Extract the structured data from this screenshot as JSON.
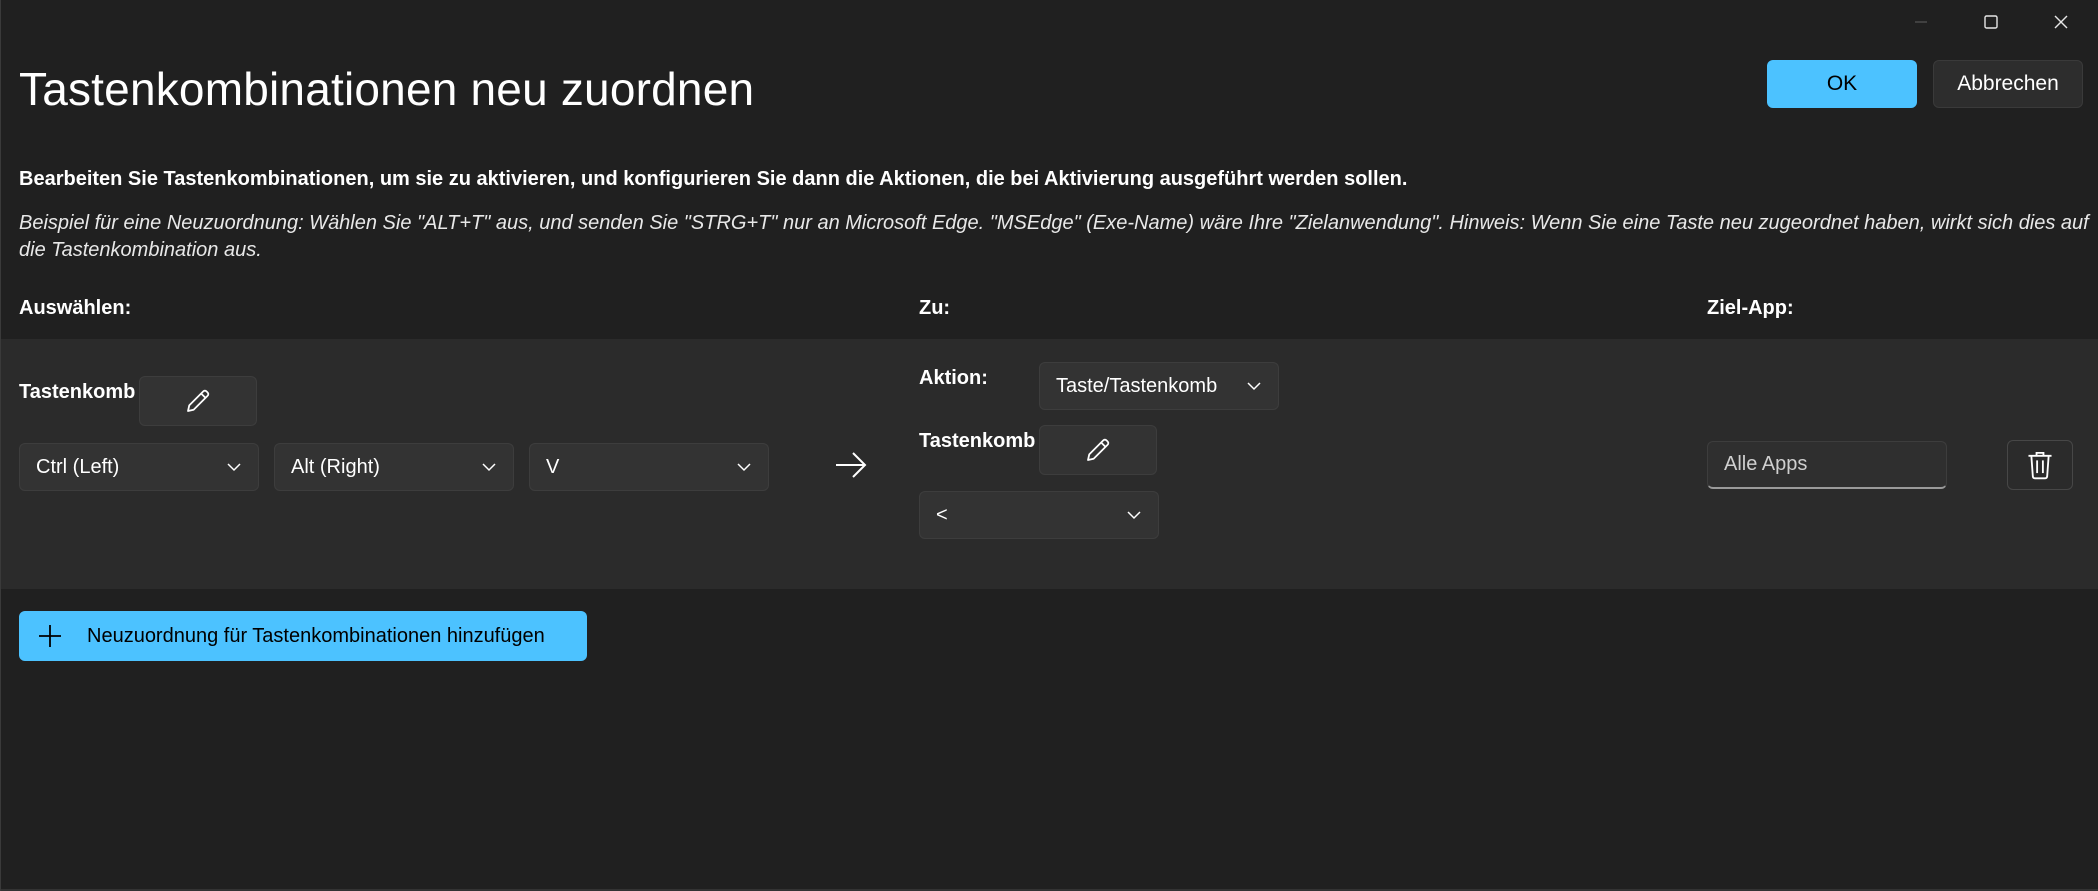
{
  "window": {
    "title": "Tastenkombinationen neu zuordnen",
    "ok_label": "OK",
    "cancel_label": "Abbrechen"
  },
  "description": {
    "main": "Bearbeiten Sie Tastenkombinationen, um sie zu aktivieren, und konfigurieren Sie dann die Aktionen, die bei Aktivierung ausgeführt werden sollen.",
    "example": "Beispiel für eine Neuzuordnung: Wählen Sie \"ALT+T\" aus, und senden Sie \"STRG+T\" nur an Microsoft Edge. \"MSEdge\" (Exe-Name) wäre Ihre \"Zielanwendung\". Hinweis: Wenn Sie eine Taste neu zugeordnet haben, wirkt sich dies auf die Tastenkombination aus."
  },
  "columns": {
    "select": "Auswählen:",
    "to": "Zu:",
    "target_app": "Ziel-App:"
  },
  "row": {
    "source": {
      "label": "Tastenkomb",
      "keys": [
        "Ctrl (Left)",
        "Alt (Right)",
        "V"
      ]
    },
    "target": {
      "action_label": "Aktion:",
      "action_value": "Taste/Tastenkomb",
      "shortcut_label": "Tastenkomb",
      "key_value": "<"
    },
    "target_app_placeholder": "Alle Apps"
  },
  "add_button_label": "Neuzuordnung für Tastenkombinationen hinzufügen",
  "colors": {
    "accent": "#4cc2ff",
    "background": "#202020",
    "panel": "#2b2b2b",
    "control": "#333333"
  },
  "icons": {
    "minimize": "minimize-icon",
    "maximize": "maximize-icon",
    "close": "close-icon",
    "edit": "pencil-icon",
    "chevron": "chevron-down-icon",
    "arrow": "arrow-right-icon",
    "delete": "trash-icon",
    "add": "plus-icon"
  }
}
